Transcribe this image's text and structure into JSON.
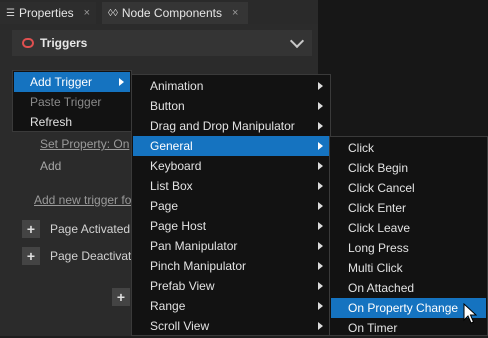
{
  "tabs": [
    {
      "label": "Properties",
      "close": "×"
    },
    {
      "label": "Node Components",
      "close": "×"
    }
  ],
  "section": {
    "title": "Triggers"
  },
  "background": {
    "set_property": "Set Property: On",
    "add": "Add",
    "add_new_trigger": "Add new trigger fo",
    "page_activated": "Page Activated",
    "page_deactivated": "Page Deactivat",
    "plus": "+"
  },
  "menu1": [
    {
      "label": "Add Trigger",
      "state": "selected",
      "submenu": true
    },
    {
      "label": "Paste Trigger",
      "state": "disabled",
      "submenu": false
    },
    {
      "label": "Refresh",
      "state": "normal",
      "submenu": false
    }
  ],
  "menu2": [
    {
      "label": "Animation",
      "submenu": true
    },
    {
      "label": "Button",
      "submenu": true
    },
    {
      "label": "Drag and Drop Manipulator",
      "submenu": true
    },
    {
      "label": "General",
      "submenu": true,
      "selected": true
    },
    {
      "label": "Keyboard",
      "submenu": true
    },
    {
      "label": "List Box",
      "submenu": true
    },
    {
      "label": "Page",
      "submenu": true
    },
    {
      "label": "Page Host",
      "submenu": true
    },
    {
      "label": "Pan Manipulator",
      "submenu": true
    },
    {
      "label": "Pinch Manipulator",
      "submenu": true
    },
    {
      "label": "Prefab View",
      "submenu": true
    },
    {
      "label": "Range",
      "submenu": true
    },
    {
      "label": "Scroll View",
      "submenu": true
    }
  ],
  "menu3": [
    {
      "label": "Click"
    },
    {
      "label": "Click Begin"
    },
    {
      "label": "Click Cancel"
    },
    {
      "label": "Click Enter"
    },
    {
      "label": "Click Leave"
    },
    {
      "label": "Long Press"
    },
    {
      "label": "Multi Click"
    },
    {
      "label": "On Attached"
    },
    {
      "label": "On Property Change",
      "selected": true
    },
    {
      "label": "On Timer"
    }
  ],
  "colors": {
    "accent": "#1573c0",
    "trigger_icon": "#e05050"
  },
  "icons": {
    "properties_tab": "list-icon",
    "node_components_tab": "components-icon",
    "triggers": "trigger-icon",
    "section_toggle": "chevron-down-icon"
  }
}
